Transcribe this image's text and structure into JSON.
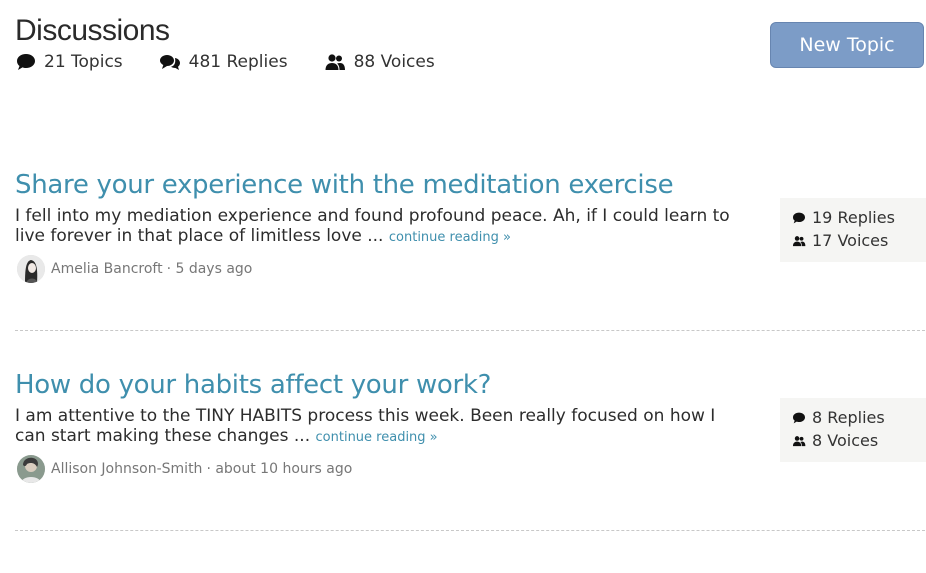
{
  "header": {
    "title": "Discussions",
    "topics": "21 Topics",
    "replies": "481 Replies",
    "voices": "88 Voices",
    "new_topic_label": "New Topic"
  },
  "topics": [
    {
      "title": "Share your experience with the meditation exercise",
      "excerpt_line1": "I fell into my mediation experience and found profound peace. Ah, if I could learn to",
      "excerpt_line2": "live forever in that place of limitless love ...",
      "continue_label": "continue reading »",
      "author": "Amelia Bancroft",
      "time": "· 5 days ago",
      "replies": "19 Replies",
      "voices": "17 Voices"
    },
    {
      "title": "How do your habits affect your work?",
      "excerpt_line1": "I am attentive to the TINY HABITS process this week. Been really focused on how I",
      "excerpt_line2": "can start making these changes ...",
      "continue_label": "continue reading »",
      "author": "Allison Johnson-Smith",
      "time": "· about 10 hours ago",
      "replies": "8 Replies",
      "voices": "8 Voices"
    }
  ],
  "colors": {
    "link": "#3f8fad",
    "button": "#7c9cc7",
    "stats_bg": "#f5f5f3"
  }
}
